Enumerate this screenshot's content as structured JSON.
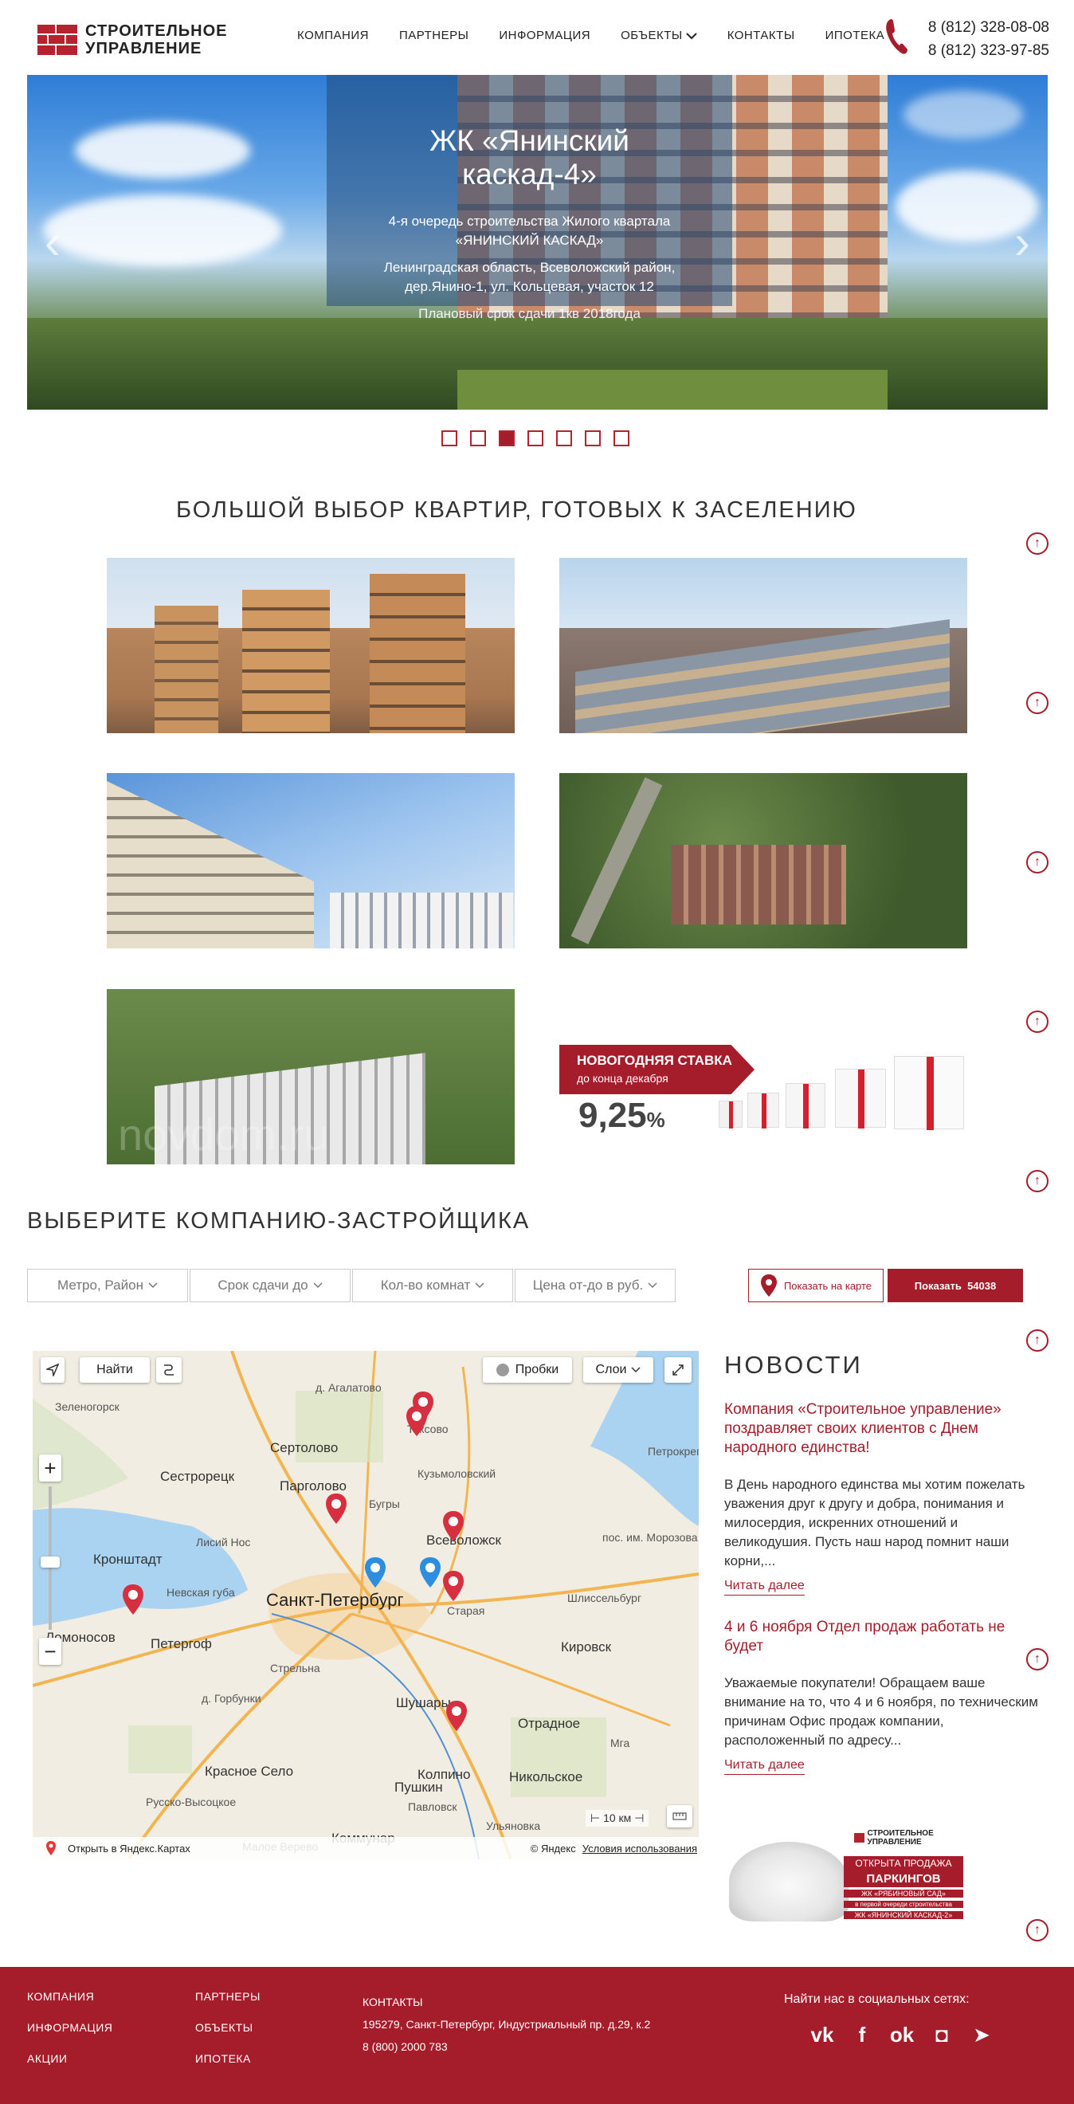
{
  "header": {
    "logo_line1": "Строительное",
    "logo_line2": "Управление",
    "nav": [
      "Компания",
      "Партнеры",
      "Информация",
      "Объекты",
      "Контакты",
      "Ипотека"
    ],
    "phone1": "8 (812) 328-08-08",
    "phone2": "8 (812) 323-97-85"
  },
  "slider": {
    "title_line1": "ЖК «Янинский",
    "title_line2": "каскад-4»",
    "subtitle_line1": "4-я очередь строительства Жилого квартала",
    "subtitle_line2": "«ЯНИНСКИЙ КАСКАД»",
    "address_line1": "Ленинградская область, Всеволожский район,",
    "address_line2": "дер.Янино-1, ул. Кольцевая, участок 12",
    "date_partial": "Плановый срок сдачи 1кв 2018года",
    "active_dot": 3,
    "dots_count": 7
  },
  "gallery": {
    "title": "Большой выбор квартир, готовых к заселению",
    "promo_label1": "НОВОГОДНЯЯ СТАВКА",
    "promo_label2": "до конца декабря",
    "promo_rate": "9,25",
    "promo_pct": "%",
    "watermark": "novdom.ru"
  },
  "search": {
    "title": "Выберите компанию-застройщика",
    "filters": [
      "Метро, Район",
      "Срок сдачи до",
      "Кол-во комнат",
      "Цена от-до в руб."
    ],
    "map_button": "Показать на карте",
    "show_button_label": "Показать",
    "show_count": "54038"
  },
  "map": {
    "find_button": "Найти",
    "traffic_button": "Пробки",
    "layers_button": "Слои",
    "scale": "10 км",
    "open_link": "Открыть в Яндекс.Картах",
    "copyright": "© Яндекс",
    "terms": "Условия использования",
    "cities": [
      {
        "name": "Зеленогорск",
        "cls": "small"
      },
      {
        "name": "д. Агалатово",
        "cls": "small"
      },
      {
        "name": "Сертолово",
        "cls": ""
      },
      {
        "name": "Сестрорецк",
        "cls": ""
      },
      {
        "name": "Парголово",
        "cls": ""
      },
      {
        "name": "Кузьмоловский",
        "cls": "small"
      },
      {
        "name": "Бугры",
        "cls": "small"
      },
      {
        "name": "Лисий Нос",
        "cls": "small"
      },
      {
        "name": "Кронштадт",
        "cls": ""
      },
      {
        "name": "Невская губа",
        "cls": "small"
      },
      {
        "name": "Санкт-Петербург",
        "cls": "big"
      },
      {
        "name": "Всеволожск",
        "cls": ""
      },
      {
        "name": "Старая",
        "cls": "small"
      },
      {
        "name": "Шлиссельбург",
        "cls": "small"
      },
      {
        "name": "Ломоносов",
        "cls": ""
      },
      {
        "name": "Петергоф",
        "cls": ""
      },
      {
        "name": "Стрельна",
        "cls": "small"
      },
      {
        "name": "Кировск",
        "cls": ""
      },
      {
        "name": "д. Горбунки",
        "cls": "small"
      },
      {
        "name": "Шушары",
        "cls": ""
      },
      {
        "name": "Отрадное",
        "cls": ""
      },
      {
        "name": "Колпино",
        "cls": ""
      },
      {
        "name": "Красное Село",
        "cls": ""
      },
      {
        "name": "Пушкин",
        "cls": ""
      },
      {
        "name": "Никольское",
        "cls": ""
      },
      {
        "name": "Русско-Высоцкое",
        "cls": "small"
      },
      {
        "name": "Павловск",
        "cls": "small"
      },
      {
        "name": "Ульяновка",
        "cls": "small"
      },
      {
        "name": "Коммунар",
        "cls": ""
      },
      {
        "name": "Малое Верево",
        "cls": "small"
      },
      {
        "name": "Мга",
        "cls": "small"
      },
      {
        "name": "Петрокрепость",
        "cls": "small"
      },
      {
        "name": "пос. им. Морозова",
        "cls": "small"
      },
      {
        "name": "Токсово",
        "cls": "small"
      }
    ]
  },
  "news": {
    "title": "Новости",
    "items": [
      {
        "title": "Компания «Строительное управление» поздравляет своих клиентов с Днем народного единства!",
        "text": "В День народного единства мы хотим пожелать уважения друг к другу и добра, понимания и милосердия, искренних отношений и великодушия. Пусть наш народ помнит наши корни,...",
        "more": "Читать далее"
      },
      {
        "title": "4 и 6 ноября Отдел продаж работать не будет",
        "text": "Уважаемые покупатели! Обращаем ваше внимание на то, что 4 и 6 ноября, по техническим причинам Офис продаж компании, расположенный по адресу...",
        "more": "Читать далее"
      }
    ],
    "promo_logo": "Строительное управление",
    "promo_line1": "ОТКРЫТА ПРОДАЖА",
    "promo_line2": "ПАРКИНГОВ",
    "promo_line3": "ЖК «РЯБИНОВЫЙ САД»",
    "promo_line4": "в первой очереди строительства",
    "promo_line5": "ЖК «ЯНИНСКИЙ КАСКАД-2»"
  },
  "footer": {
    "col1": [
      "Компания",
      "Информация",
      "Акции"
    ],
    "col2": [
      "Партнеры",
      "Объекты",
      "Ипотека"
    ],
    "contacts_title": "КОНТАКТЫ",
    "address": "195279, Санкт-Петербург, Индустриальный пр. д.29, к.2",
    "phone": "8 (800) 2000 783",
    "social_title": "Найти нас в социальных сетях:",
    "social_icons": [
      "vk-icon",
      "facebook-icon",
      "odnoklassniki-icon",
      "instagram-icon",
      "telegram-icon"
    ]
  },
  "colors": {
    "brand": "#a51c2a",
    "accent_red": "#b5242e"
  }
}
